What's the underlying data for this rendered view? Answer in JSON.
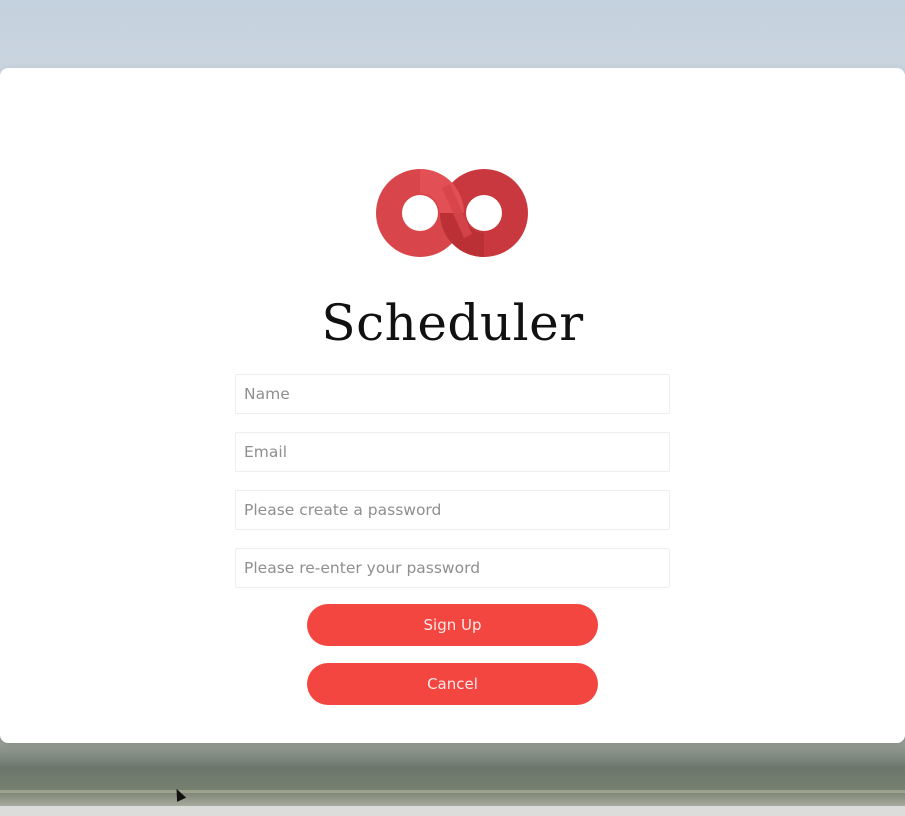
{
  "app": {
    "title": "Scheduler",
    "brand_color": "#f34640",
    "logo_icon": "infinity-logo-icon"
  },
  "form": {
    "name_placeholder": "Name",
    "email_placeholder": "Email",
    "password_placeholder": "Please create a password",
    "confirm_password_placeholder": "Please re-enter your password"
  },
  "buttons": {
    "signup_label": "Sign Up",
    "cancel_label": "Cancel"
  }
}
